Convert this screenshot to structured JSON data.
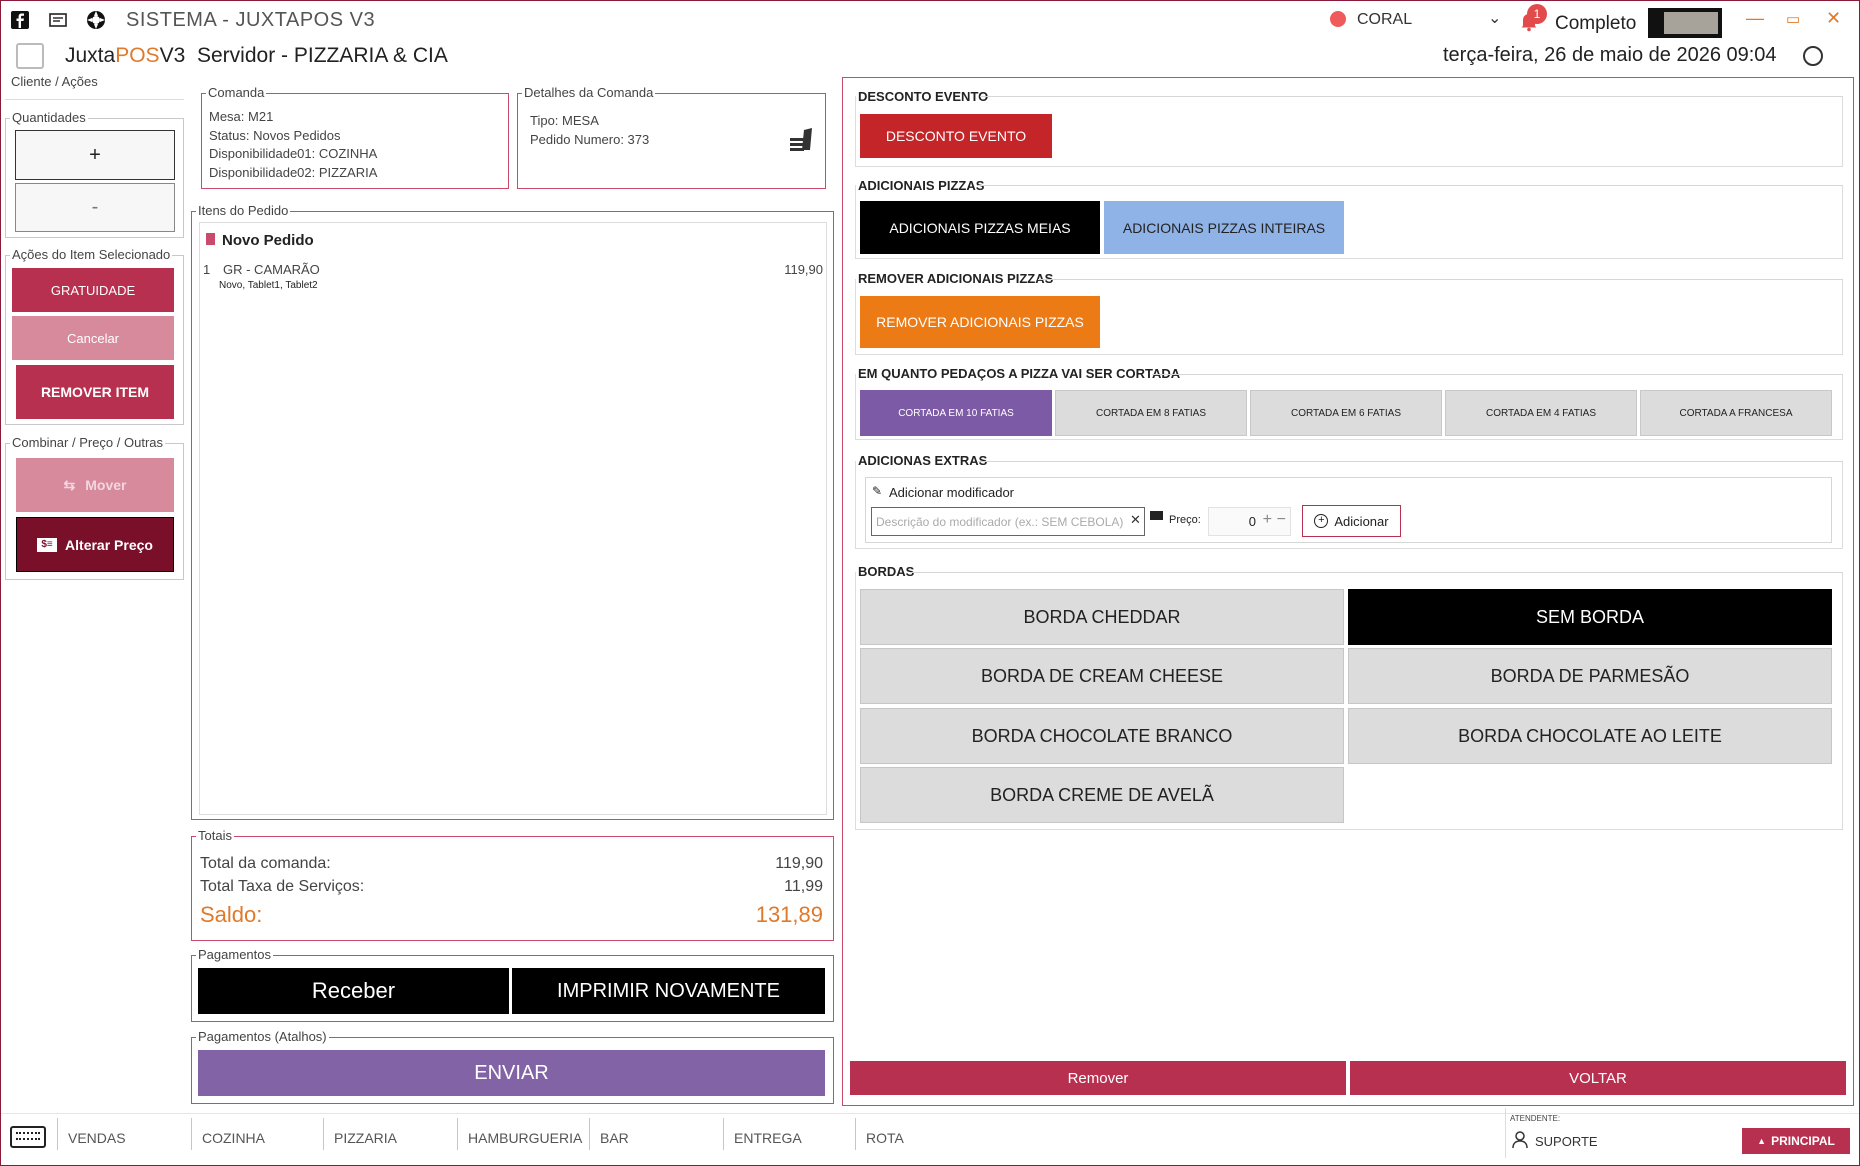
{
  "window": {
    "title": "SISTEMA - JUXTAPOS V3",
    "location": "CORAL",
    "notifications": "1",
    "mode": "Completo"
  },
  "app": {
    "name_prefix": "Juxta",
    "name_highlight": "POS",
    "name_suffix": "V3",
    "server_title": "Servidor - PIZZARIA & CIA",
    "datetime": "terça-feira, 26 de maio de 2026 09:04"
  },
  "left_sidebar": {
    "cliente_legend": "Cliente / Ações",
    "quantidades_legend": "Quantidades",
    "plus_label": "+",
    "minus_label": "-",
    "acoes_legend": "Ações do Item Selecionado",
    "gratuidade_label": "GRATUIDADE",
    "cancelar_label": "Cancelar",
    "remover_item_label": "REMOVER ITEM",
    "combinar_legend": "Combinar / Preço / Outras",
    "mover_label": "Mover",
    "alterar_preco_label": "Alterar Preço"
  },
  "comanda": {
    "legend": "Comanda",
    "mesa": "Mesa: M21",
    "status": "Status: Novos Pedidos",
    "disp1": "Disponibilidade01: COZINHA",
    "disp2": "Disponibilidade02: PIZZARIA"
  },
  "detalhes": {
    "legend": "Detalhes da Comanda",
    "tipo": "Tipo: MESA",
    "pedido": "Pedido Numero: 373"
  },
  "itens": {
    "legend": "Itens do Pedido",
    "header": "Novo Pedido",
    "items": [
      {
        "qty": "1",
        "name": "GR - CAMARÃO",
        "price": "119,90",
        "tags": "Novo, Tablet1, Tablet2"
      }
    ]
  },
  "totais": {
    "legend": "Totais",
    "total_label": "Total da comanda:",
    "total_value": "119,90",
    "taxa_label": "Total Taxa de Serviços:",
    "taxa_value": "11,99",
    "saldo_label": "Saldo:",
    "saldo_value": "131,89"
  },
  "pagamentos": {
    "legend": "Pagamentos",
    "receber_label": "Receber",
    "imprimir_label": "IMPRIMIR NOVAMENTE",
    "atalhos_legend": "Pagamentos (Atalhos)",
    "enviar_label": "ENVIAR"
  },
  "right": {
    "desconto_title": "DESCONTO EVENTO",
    "desconto_button": "DESCONTO EVENTO",
    "adicionais_title": "ADICIONAIS PIZZAS",
    "adicionais_meias": "ADICIONAIS PIZZAS MEIAS",
    "adicionais_inteiras": "ADICIONAIS PIZZAS INTEIRAS",
    "remover_title": "REMOVER ADICIONAIS PIZZAS",
    "remover_button": "REMOVER ADICIONAIS PIZZAS",
    "cortes_title": "EM QUANTO PEDAÇOS A PIZZA VAI SER CORTADA",
    "cortes": [
      "CORTADA EM 10 FATIAS",
      "CORTADA EM 8 FATIAS",
      "CORTADA EM 6 FATIAS",
      "CORTADA EM 4 FATIAS",
      "CORTADA A FRANCESA"
    ],
    "extras_title": "ADICIONAS EXTRAS",
    "modificador_label": "Adicionar modificador",
    "modificador_placeholder": "Descrição do modificador (ex.: SEM CEBOLA)",
    "preco_label": "Preço:",
    "preco_value": "0",
    "adicionar_label": "Adicionar",
    "bordas_title": "BORDAS",
    "bordas": [
      "BORDA CHEDDAR",
      "SEM BORDA",
      "BORDA DE CREAM CHEESE",
      "BORDA DE PARMESÃO",
      "BORDA CHOCOLATE BRANCO",
      "BORDA CHOCOLATE AO LEITE",
      "BORDA CREME DE AVELÃ"
    ],
    "remover_label": "Remover",
    "voltar_label": "VOLTAR"
  },
  "bottom": {
    "tabs": [
      "VENDAS",
      "COZINHA",
      "PIZZARIA",
      "HAMBURGUERIA",
      "BAR",
      "ENTREGA",
      "ROTA"
    ],
    "atendente_label": "ATENDENTE:",
    "atendente_name": "SUPORTE",
    "principal_label": "PRINCIPAL"
  },
  "colors": {
    "accent_crimson": "#b8304f",
    "accent_orange": "#e07a2a",
    "accent_purple": "#8264a6",
    "red_button": "#c42528",
    "orange_button": "#ec7a15",
    "lightblue_button": "#8fb3e6"
  }
}
